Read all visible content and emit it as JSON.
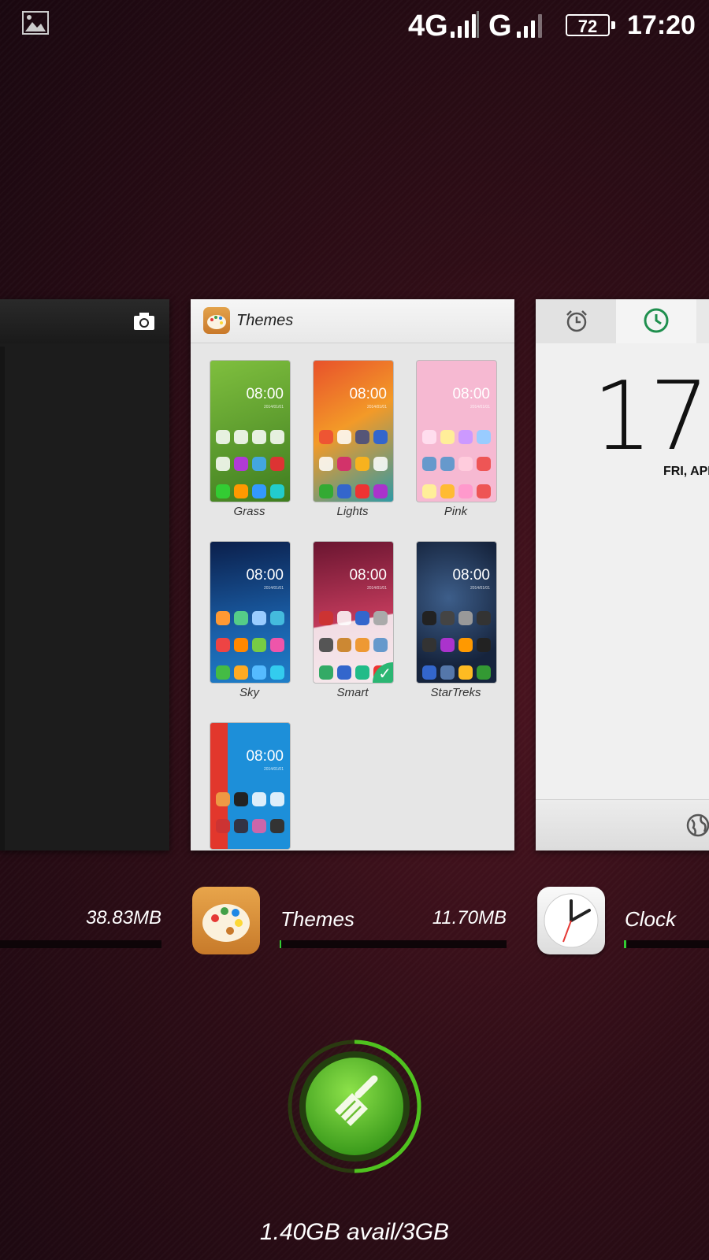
{
  "status_bar": {
    "network1": "4G",
    "network2": "G",
    "battery": "72",
    "time": "17:20"
  },
  "themes_card": {
    "title": "Themes",
    "tile_clock": "08:00",
    "tile_date": "2014/01/01",
    "themes": [
      "Grass",
      "Lights",
      "Pink",
      "Sky",
      "Smart",
      "StarTreks"
    ]
  },
  "clock_card": {
    "time": "17:",
    "date": "FRI, APR"
  },
  "apps": [
    {
      "name": "",
      "memory": "38.83MB"
    },
    {
      "name": "Themes",
      "memory": "11.70MB"
    },
    {
      "name": "Clock",
      "memory": ""
    }
  ],
  "memory_summary": "1.40GB avail/3GB"
}
